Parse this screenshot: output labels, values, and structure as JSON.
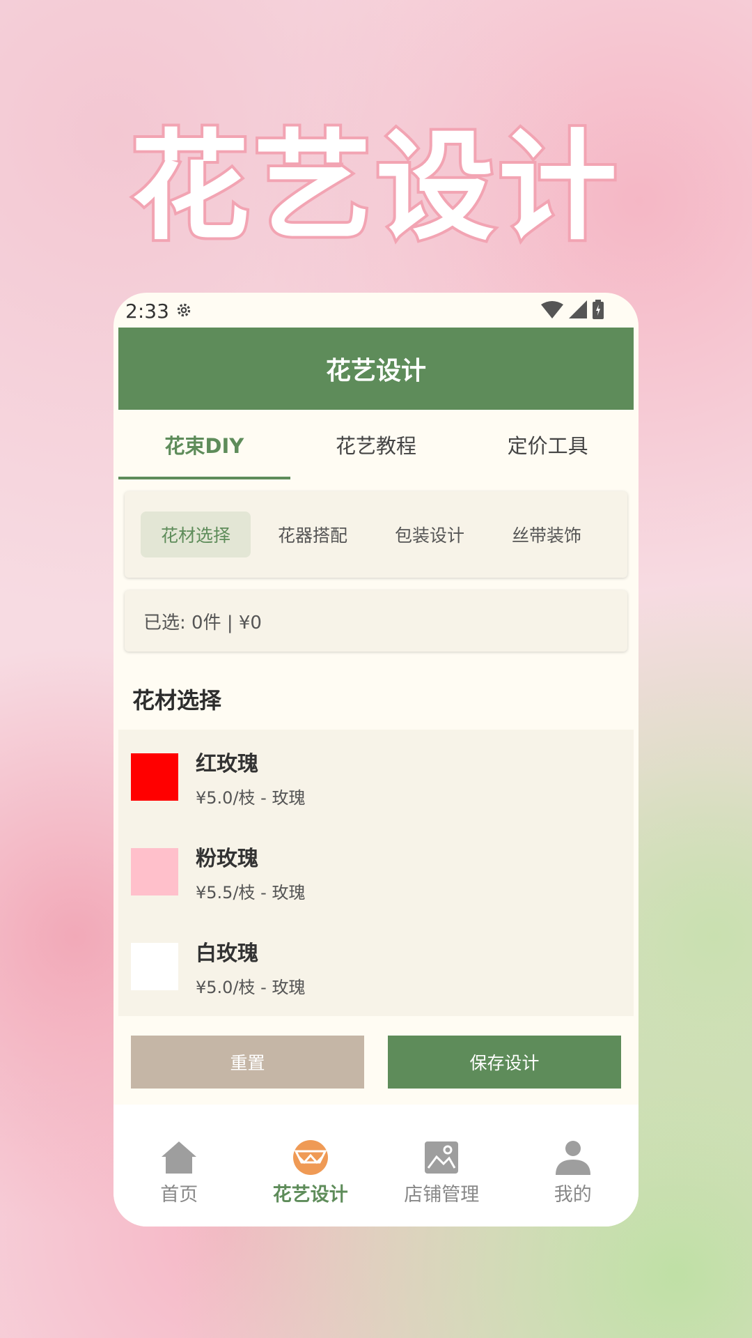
{
  "promo": {
    "title": "花艺设计"
  },
  "status": {
    "time": "2:33"
  },
  "app_bar": {
    "title": "花艺设计"
  },
  "tabs": [
    {
      "label": "花束DIY",
      "active": true
    },
    {
      "label": "花艺教程",
      "active": false
    },
    {
      "label": "定价工具",
      "active": false
    }
  ],
  "subtabs": [
    {
      "label": "花材选择",
      "active": true
    },
    {
      "label": "花器搭配",
      "active": false
    },
    {
      "label": "包装设计",
      "active": false
    },
    {
      "label": "丝带装饰",
      "active": false
    }
  ],
  "summary": {
    "text": "已选: 0件 | ¥0"
  },
  "section": {
    "title": "花材选择"
  },
  "flowers": [
    {
      "name": "红玫瑰",
      "price": "¥5.0/枝 - 玫瑰",
      "color": "#ff0000"
    },
    {
      "name": "粉玫瑰",
      "price": "¥5.5/枝 - 玫瑰",
      "color": "#ffc0cb"
    },
    {
      "name": "白玫瑰",
      "price": "¥5.0/枝 - 玫瑰",
      "color": "#ffffff"
    }
  ],
  "buttons": {
    "reset": "重置",
    "save": "保存设计"
  },
  "nav": [
    {
      "label": "首页",
      "icon": "home-icon",
      "active": false
    },
    {
      "label": "花艺设计",
      "icon": "flower-design-icon",
      "active": true
    },
    {
      "label": "店铺管理",
      "icon": "image-icon",
      "active": false
    },
    {
      "label": "我的",
      "icon": "person-icon",
      "active": false
    }
  ],
  "colors": {
    "primary": "#5e8c5a",
    "accent": "#ef9a55",
    "reset": "#c5b6a6"
  }
}
